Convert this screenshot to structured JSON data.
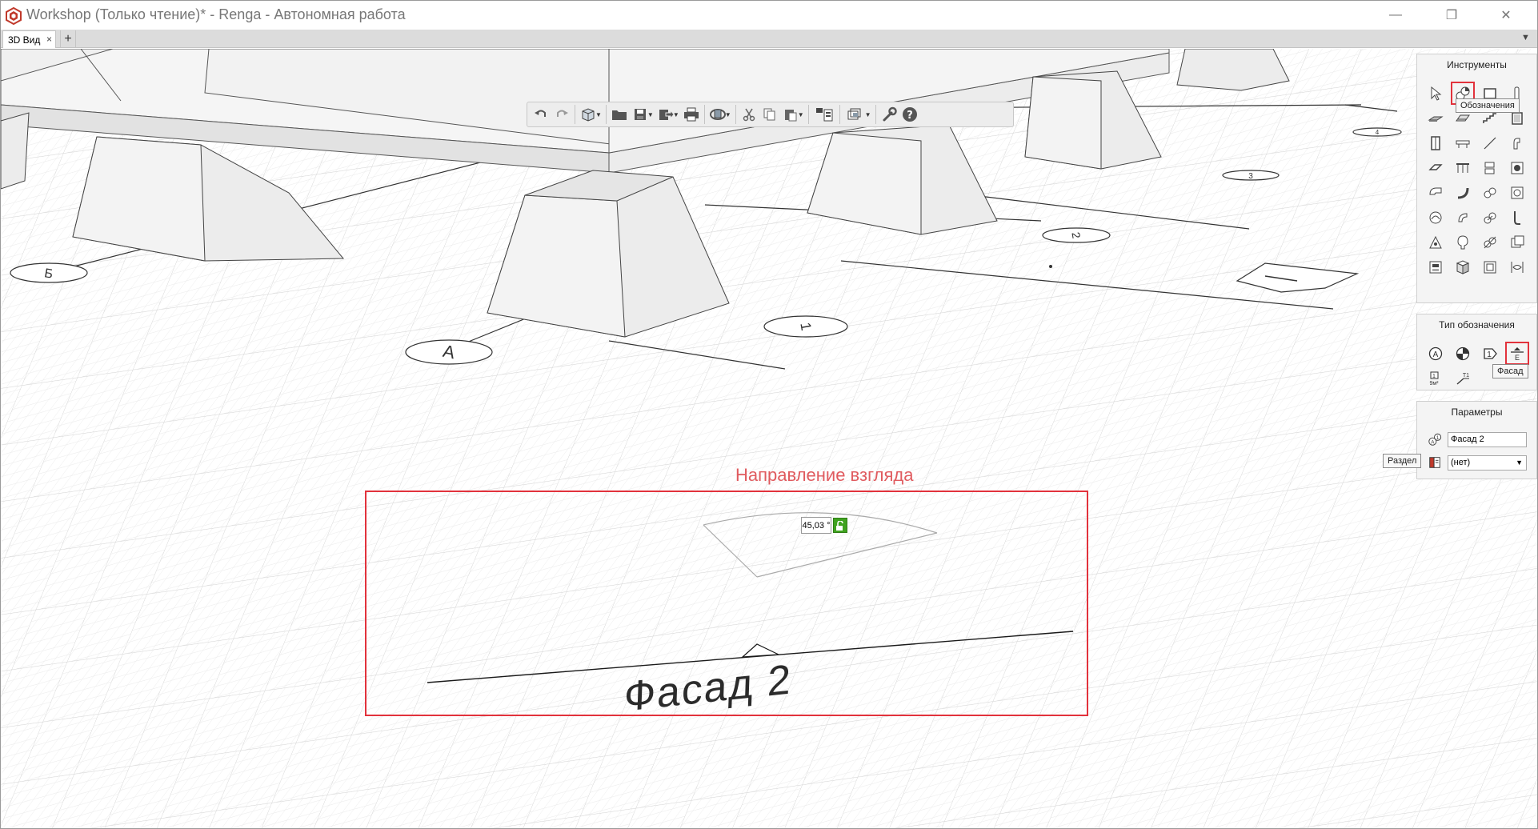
{
  "window": {
    "title": "Workshop (Только чтение)* - Renga - Автономная работа",
    "minimize_glyph": "—",
    "maximize_glyph": "❐",
    "close_glyph": "✕"
  },
  "tabs": {
    "items": [
      {
        "label": "3D Вид",
        "close_glyph": "×"
      }
    ],
    "add_glyph": "+",
    "menu_glyph": "▼"
  },
  "toolbar": {
    "items": [
      "undo-icon",
      "redo-icon",
      "view-cube-icon",
      "open-folder-icon",
      "save-icon",
      "export-icon",
      "print-icon",
      "orbit-icon",
      "cut-icon",
      "copy-icon",
      "paste-icon",
      "layers-icon",
      "display-mode-icon",
      "settings-wrench-icon",
      "help-icon"
    ]
  },
  "tools_panel": {
    "title": "Инструменты",
    "tooltip": "Обозначения",
    "tools": [
      "select",
      "annotation",
      "wall",
      "column",
      "slab",
      "roof",
      "stair",
      "window",
      "door",
      "beam",
      "line",
      "equipment",
      "plate",
      "railing",
      "furniture",
      "pipe",
      "duct",
      "route",
      "fitting",
      "valve",
      "mechanical",
      "electrical",
      "lighting",
      "cable",
      "room",
      "isolated-foundation",
      "element",
      "assembly",
      "axis",
      "dimension",
      "hatch",
      "text"
    ]
  },
  "annotation_type_panel": {
    "title": "Тип обозначения",
    "tooltip": "Фасад",
    "types": [
      {
        "name": "axis-mark",
        "glyph": "A"
      },
      {
        "name": "section-mark",
        "glyph": ""
      },
      {
        "name": "level-mark",
        "glyph": "1"
      },
      {
        "name": "facade-mark",
        "glyph": "E"
      },
      {
        "name": "area-mark",
        "glyph": "9м²"
      },
      {
        "name": "leader-mark",
        "glyph": "T1"
      }
    ]
  },
  "params_panel": {
    "title": "Параметры",
    "name_value": "Фасад 2",
    "section_value": "(нет)",
    "section_tooltip": "Раздел"
  },
  "viewport": {
    "view_direction_caption": "Направление взгляда",
    "angle_value": "45,03 °",
    "facade_label": "Фасад 2",
    "grid_axes": [
      "Б",
      "А",
      "1",
      "2",
      "3",
      "4"
    ],
    "highlight_color": "#e2323c"
  }
}
